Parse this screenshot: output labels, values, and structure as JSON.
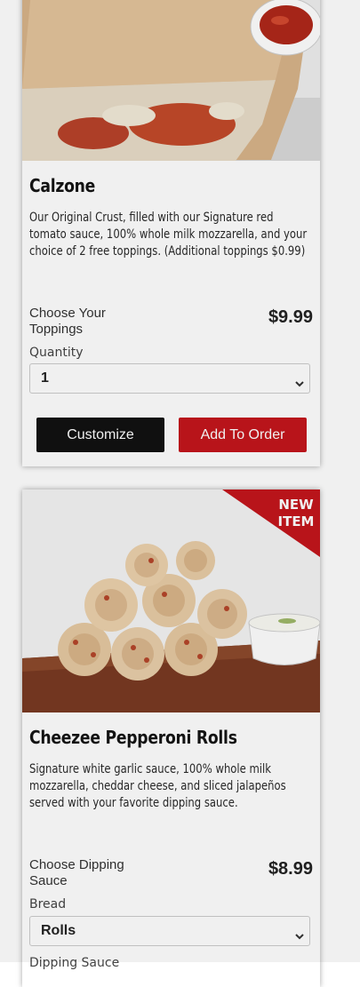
{
  "items": [
    {
      "title": "Calzone",
      "description": "Our Original Crust, filled with our Signature red tomato sauce, 100% whole milk mozzarella, and your choice of 2 free toppings. (Additional toppings $0.99)",
      "choose_label": "Choose Your Toppings",
      "price": "$9.99",
      "field_label": "Quantity",
      "field_value": "1",
      "customize_label": "Customize",
      "add_label": "Add To Order"
    },
    {
      "title": "Cheezee Pepperoni Rolls",
      "badge_line1": "NEW",
      "badge_line2": "ITEM",
      "description": "Signature white garlic sauce, 100% whole milk mozzarella, cheddar cheese, and sliced jalapeños served with your favorite dipping sauce.",
      "choose_label": "Choose Dipping Sauce",
      "price": "$8.99",
      "field_label": "Bread",
      "field_value": "Rolls",
      "next_field_label": "Dipping Sauce"
    }
  ],
  "colors": {
    "accent": "#c4161c",
    "dark_button": "#111111"
  }
}
